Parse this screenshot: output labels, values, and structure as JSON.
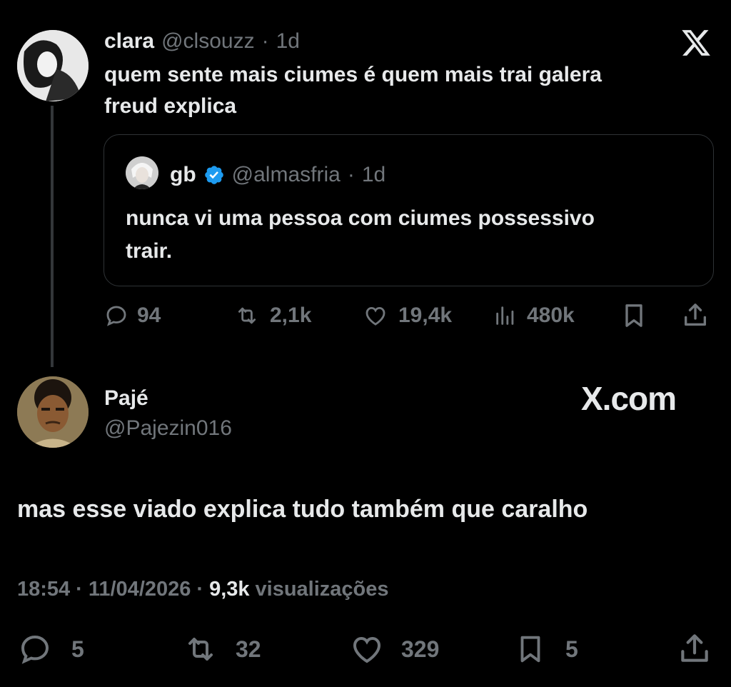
{
  "quoted_tweet": {
    "name": "clara",
    "handle": "@clsouzz",
    "age": "1d",
    "dot": "·",
    "text_line1": "quem sente mais ciumes é quem mais trai galera",
    "text_line2": "freud explica",
    "embedded": {
      "name": "gb",
      "verified": true,
      "handle": "@almasfria",
      "age": "1d",
      "text_line1": "nunca vi uma pessoa com ciumes possessivo",
      "text_line2": "trair."
    },
    "actions": {
      "replies": "94",
      "reposts": "2,1k",
      "likes": "19,4k",
      "views": "480k"
    }
  },
  "reply_tweet": {
    "name": "Pajé",
    "handle": "@Pajezin016",
    "watermark": "X.com",
    "text": "mas esse viado explica tudo também que caralho",
    "time": "18:54",
    "date": "11/04/2026",
    "views_count": "9,3k",
    "views_label": "visualizações",
    "sep": "·",
    "actions": {
      "replies": "5",
      "reposts": "32",
      "likes": "329",
      "bookmarks": "5"
    }
  },
  "icons": [
    "x-logo-icon",
    "verified-badge-icon",
    "reply-icon",
    "repost-icon",
    "like-icon",
    "views-icon",
    "bookmark-icon",
    "share-icon"
  ],
  "colors": {
    "background": "#000000",
    "text": "#e7e9ea",
    "muted": "#71767b",
    "verified": "#1d9bf0",
    "border": "#2f3336"
  }
}
